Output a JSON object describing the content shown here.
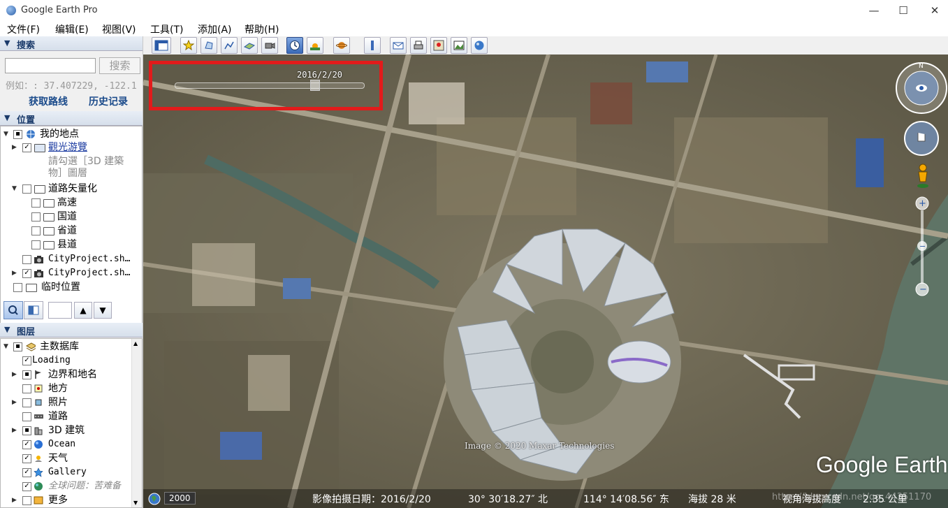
{
  "window": {
    "title": "Google Earth Pro",
    "minimize": "—",
    "maximize": "☐",
    "close": "✕"
  },
  "menu": [
    "文件(F)",
    "编辑(E)",
    "视图(V)",
    "工具(T)",
    "添加(A)",
    "帮助(H)"
  ],
  "search": {
    "header": "搜索",
    "input_value": "",
    "button": "搜索",
    "placeholder": "例如：: 37.407229, -122.1",
    "link_route": "获取路线",
    "link_history": "历史记录"
  },
  "places": {
    "header": "位置",
    "items": [
      {
        "label": "我的地点"
      },
      {
        "label": "觀光游覽"
      },
      {
        "label": "請勾選［3D 建築"
      },
      {
        "label": "物］圖層"
      },
      {
        "label": "道路矢量化"
      },
      {
        "label": "高速"
      },
      {
        "label": "国道"
      },
      {
        "label": "省道"
      },
      {
        "label": "县道"
      },
      {
        "label": "CityProject.sh…"
      },
      {
        "label": "CityProject.sh…"
      },
      {
        "label": "临时位置"
      }
    ]
  },
  "layers": {
    "header": "图层",
    "items": [
      {
        "label": "主数据库"
      },
      {
        "label": "Loading"
      },
      {
        "label": "边界和地名"
      },
      {
        "label": "地方"
      },
      {
        "label": "照片"
      },
      {
        "label": "道路"
      },
      {
        "label": "3D 建筑"
      },
      {
        "label": "Ocean"
      },
      {
        "label": "天气"
      },
      {
        "label": "Gallery"
      },
      {
        "label": "全球问题：苦难备"
      },
      {
        "label": "更多"
      }
    ]
  },
  "map": {
    "timeslider_date": "2016/2/20",
    "copyright": "Image © 2020 Maxar Technologies",
    "logo": "Google Earth",
    "history_year": "2000",
    "status": {
      "imagery_date": "影像拍摄日期：2016/2/20",
      "lat": "30° 30′18.27″ 北",
      "lon": "114° 14′08.56″ 东",
      "elevation": "海拔   28 米",
      "eye_alt": "视角海拔高度",
      "eye_alt_val": "2.35 公里"
    },
    "watermark": "https://blog.csdn.net/qq_44351170",
    "highlight_color": "#e21b1b"
  }
}
